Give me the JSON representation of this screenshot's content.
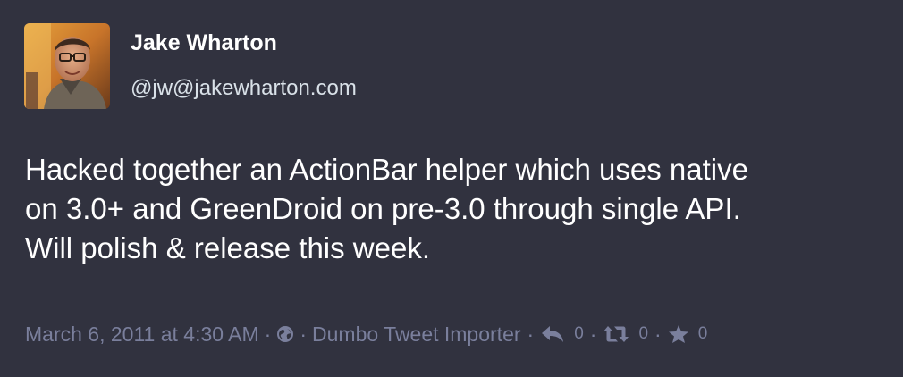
{
  "status": {
    "author": {
      "display_name": "Jake Wharton",
      "handle": "@jw@jakewharton.com"
    },
    "content": "Hacked together an ActionBar helper which uses native\non 3.0+ and GreenDroid on pre-3.0 through single API.\nWill polish & release this week.",
    "timestamp": "March 6, 2011 at 4:30 AM",
    "separator": "·",
    "visibility_icon": "globe-icon",
    "application": "Dumbo Tweet Importer",
    "replies_count": "0",
    "reblogs_count": "0",
    "favourites_count": "0"
  },
  "colors": {
    "background": "#31323f",
    "text_primary": "#ffffff",
    "text_handle": "#d9e1e8",
    "text_muted": "#7a7f9c"
  },
  "icons": {
    "reply": "reply-icon",
    "reblog": "retweet-icon",
    "favourite": "star-icon"
  }
}
